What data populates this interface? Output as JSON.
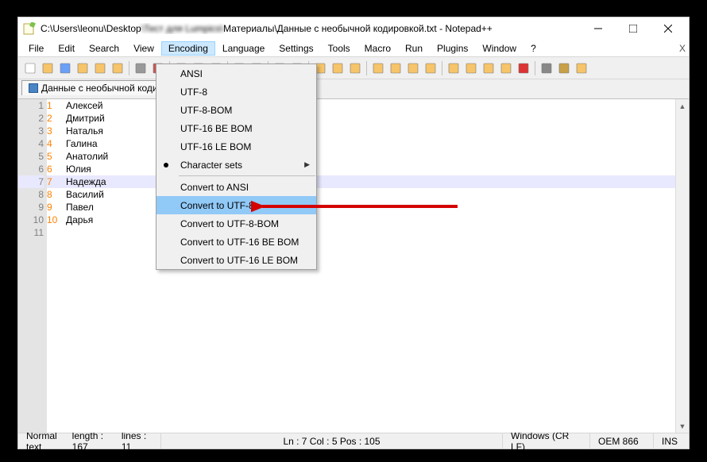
{
  "window": {
    "title_prefix": "C:\\Users\\leonu\\Desktop",
    "title_blur": "\\Тест для Lumpics\\",
    "title_suffix": "Материалы\\Данные с необычной кодировкой.txt - Notepad++"
  },
  "menu": {
    "items": [
      "File",
      "Edit",
      "Search",
      "View",
      "Encoding",
      "Language",
      "Settings",
      "Tools",
      "Macro",
      "Run",
      "Plugins",
      "Window",
      "?"
    ],
    "active": "Encoding",
    "close_x": "X"
  },
  "tab": {
    "label": "Данные с необычной коди..."
  },
  "dropdown": {
    "items": [
      {
        "label": "ANSI"
      },
      {
        "label": "UTF-8"
      },
      {
        "label": "UTF-8-BOM"
      },
      {
        "label": "UTF-16 BE BOM"
      },
      {
        "label": "UTF-16 LE BOM"
      },
      {
        "label": "Character sets",
        "bullet": true,
        "arrow": true,
        "divider_after": true
      },
      {
        "label": "Convert to ANSI"
      },
      {
        "label": "Convert to UTF-8",
        "highlight": true
      },
      {
        "label": "Convert to UTF-8-BOM"
      },
      {
        "label": "Convert to UTF-16 BE BOM"
      },
      {
        "label": "Convert to UTF-16 LE BOM"
      }
    ]
  },
  "editor": {
    "lines": [
      {
        "ln": 1,
        "num": "1",
        "name": "Алексей"
      },
      {
        "ln": 2,
        "num": "2",
        "name": "Дмитрий"
      },
      {
        "ln": 3,
        "num": "3",
        "name": "Наталья"
      },
      {
        "ln": 4,
        "num": "4",
        "name": "Галина"
      },
      {
        "ln": 5,
        "num": "5",
        "name": "Анатолий"
      },
      {
        "ln": 6,
        "num": "6",
        "name": "Юлия"
      },
      {
        "ln": 7,
        "num": "7",
        "name": "Надежда",
        "active": true
      },
      {
        "ln": 8,
        "num": "8",
        "name": "Василий"
      },
      {
        "ln": 9,
        "num": "9",
        "name": "Павел"
      },
      {
        "ln": 10,
        "num": "10",
        "name": "Дарья"
      },
      {
        "ln": 11,
        "num": "",
        "name": ""
      }
    ]
  },
  "status": {
    "type": "Normal text",
    "length": "length : 167",
    "lines": "lines : 11",
    "pos": "Ln : 7    Col : 5    Pos : 105",
    "eol": "Windows (CR LF)",
    "enc": "OEM 866",
    "ins": "INS"
  },
  "toolbar_icons": [
    "new",
    "open",
    "save",
    "save-all",
    "close",
    "close-all",
    "print",
    "cut",
    "copy",
    "paste",
    "undo",
    "redo",
    "find",
    "replace",
    "zoom-in",
    "zoom-out",
    "sync",
    "wordwrap",
    "show-all",
    "indent-guide",
    "lang",
    "folder",
    "doc-map",
    "func-list",
    "folder-open",
    "monitor",
    "record",
    "stop",
    "play",
    "play-multi"
  ]
}
